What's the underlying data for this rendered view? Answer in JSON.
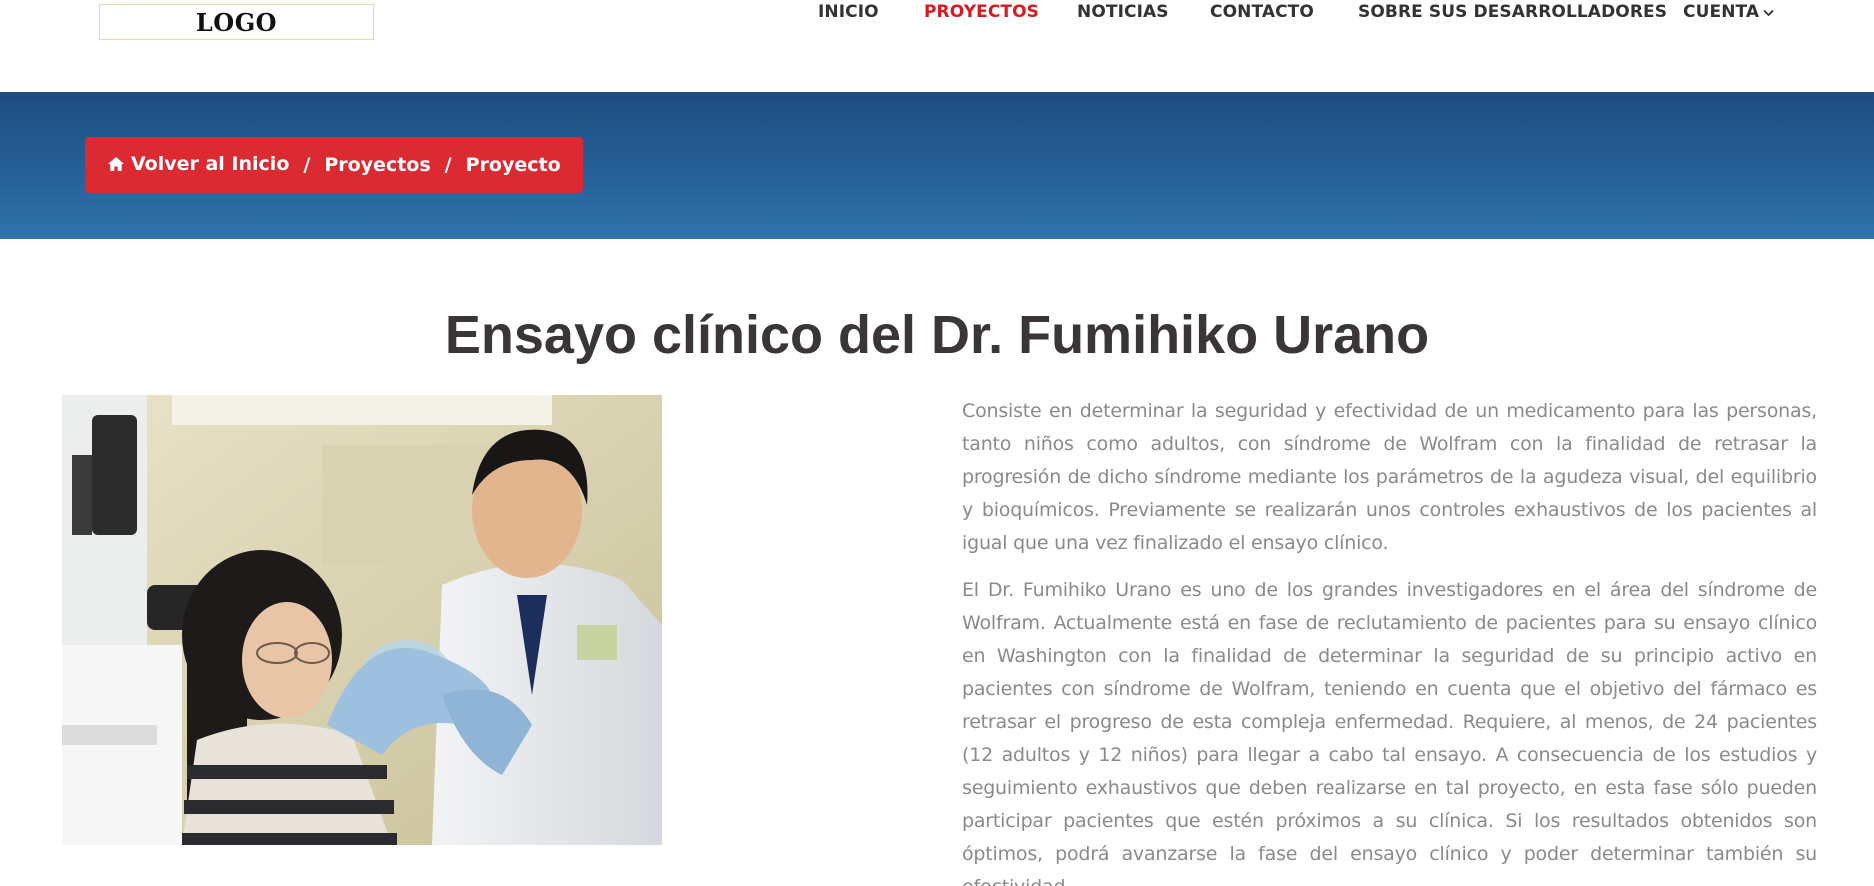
{
  "header": {
    "logo_text": "LOGO",
    "nav": [
      {
        "label": "INICIO"
      },
      {
        "label": "PROYECTOS",
        "active": true
      },
      {
        "label": "NOTICIAS"
      },
      {
        "label": "CONTACTO"
      },
      {
        "label": "SOBRE SUS DESARROLLADORES"
      },
      {
        "label": "CUENTA",
        "icon": "chevron-down-icon"
      }
    ],
    "active_color": "#d71920"
  },
  "banner": {
    "breadcrumb": [
      {
        "label": "Volver al Inicio",
        "icon": "home-icon"
      },
      {
        "label": "Proyectos"
      },
      {
        "label": "Proyecto"
      }
    ],
    "separator": "/",
    "breadcrumb_color": "#dc2a33"
  },
  "main": {
    "title": "Ensayo clínico del Dr. Fumihiko Urano",
    "paragraphs": [
      "Consiste en determinar la seguridad y efectividad de un medicamento para las personas, tanto niños como adultos, con síndrome de Wolfram con la finalidad de retrasar la progresión de dicho síndrome mediante los parámetros de la agudeza visual, del equilibrio y bioquímicos. Previamente se realizarán unos controles exhaustivos de los pacientes al igual que una vez finalizado el ensayo clínico.",
      "El Dr. Fumihiko Urano es uno de los grandes investigadores en el área del síndrome de Wolfram. Actualmente está en fase de reclutamiento de pacientes para su ensayo clínico en Washington con la finalidad de determinar la seguridad de su principio activo en pacientes con síndrome de Wolfram, teniendo en cuenta que el objetivo del fármaco es retrasar el progreso de esta compleja enfermedad. Requiere, al menos, de 24 pacientes (12 adultos y 12 niños) para llegar a cabo tal ensayo. A consecuencia de los estudios y seguimiento exhaustivos que deben realizarse en tal proyecto, en esta fase sólo pueden participar pacientes que estén próximos a su clínica. Si los resultados obtenidos son óptimos, podrá avanzarse la fase del ensayo clínico y poder determinar también su efectividad."
    ]
  }
}
